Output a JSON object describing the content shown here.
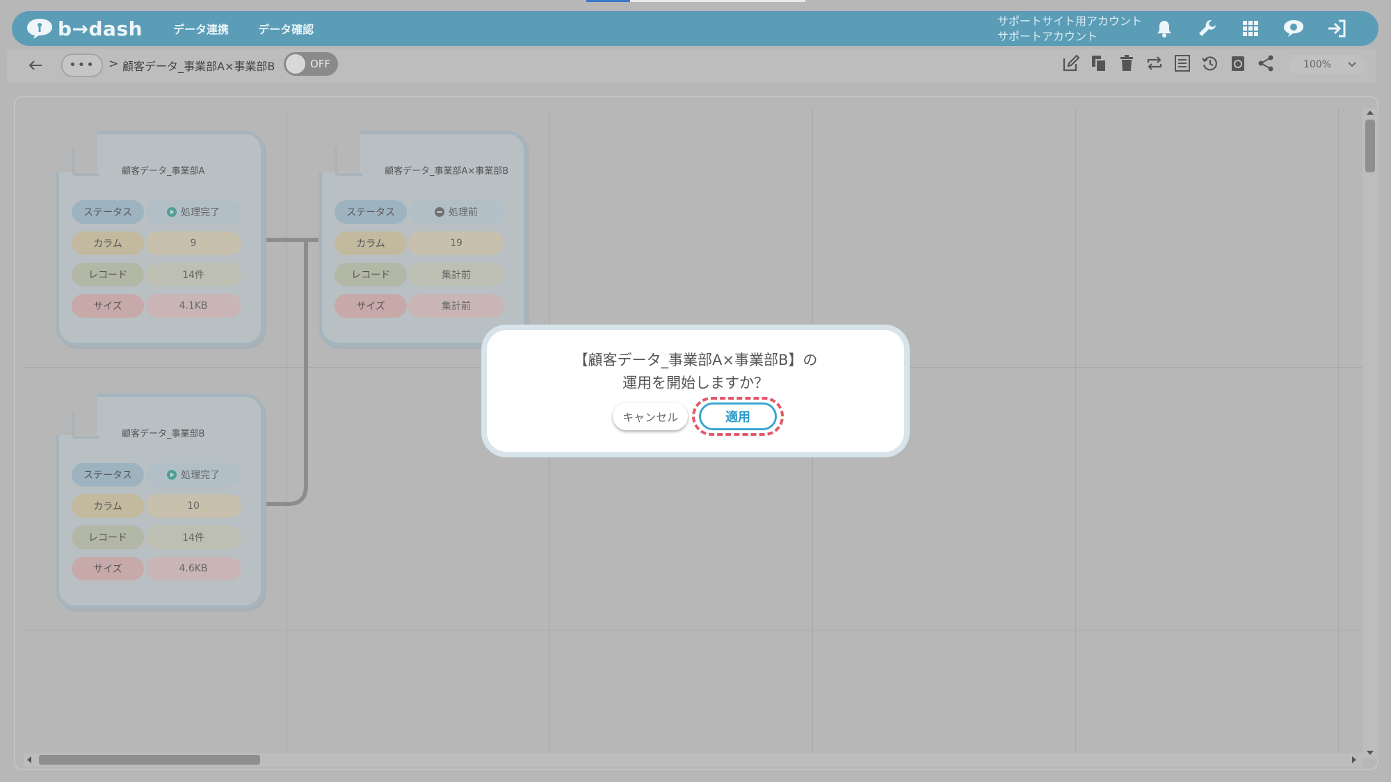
{
  "app": {
    "logo_text": "b→dash",
    "nav": [
      "データ連携",
      "データ確認"
    ],
    "account_line1": "サポートサイト用アカウント",
    "account_line2": "サポートアカウント",
    "header_icons": [
      "bell-icon",
      "wrench-icon",
      "grid-icon",
      "chat-icon",
      "logout-icon"
    ]
  },
  "toolbar": {
    "more_label": "•••",
    "separator": ">",
    "breadcrumb": "顧客データ_事業部A×事業部B",
    "toggle_label": "OFF",
    "tool_icons": [
      "edit-icon",
      "copy-icon",
      "trash-icon",
      "repeat-icon",
      "list-icon",
      "history-icon",
      "refresh-icon",
      "share-icon"
    ],
    "zoom": "100%"
  },
  "cards": [
    {
      "title": "顧客データ_事業部A",
      "status_label": "ステータス",
      "status_value": "処理完了",
      "status_icon": "play-icon",
      "column_label": "カラム",
      "column_value": "9",
      "record_label": "レコード",
      "record_value": "14件",
      "size_label": "サイズ",
      "size_value": "4.1KB"
    },
    {
      "title": "顧客データ_事業部A×事業部B",
      "status_label": "ステータス",
      "status_value": "処理前",
      "status_icon": "minus-icon",
      "column_label": "カラム",
      "column_value": "19",
      "record_label": "レコード",
      "record_value": "集計前",
      "size_label": "サイズ",
      "size_value": "集計前"
    },
    {
      "title": "顧客データ_事業部B",
      "status_label": "ステータス",
      "status_value": "処理完了",
      "status_icon": "play-icon",
      "column_label": "カラム",
      "column_value": "10",
      "record_label": "レコード",
      "record_value": "14件",
      "size_label": "サイズ",
      "size_value": "4.6KB"
    }
  ],
  "dialog": {
    "line1": "【顧客データ_事業部A×事業部B】の",
    "line2": "運用を開始しますか？",
    "cancel": "キャンセル",
    "apply": "適用"
  },
  "colors": {
    "header": "#5b9db7",
    "apply": "#3aa6d3",
    "highlight": "#e2586c"
  }
}
